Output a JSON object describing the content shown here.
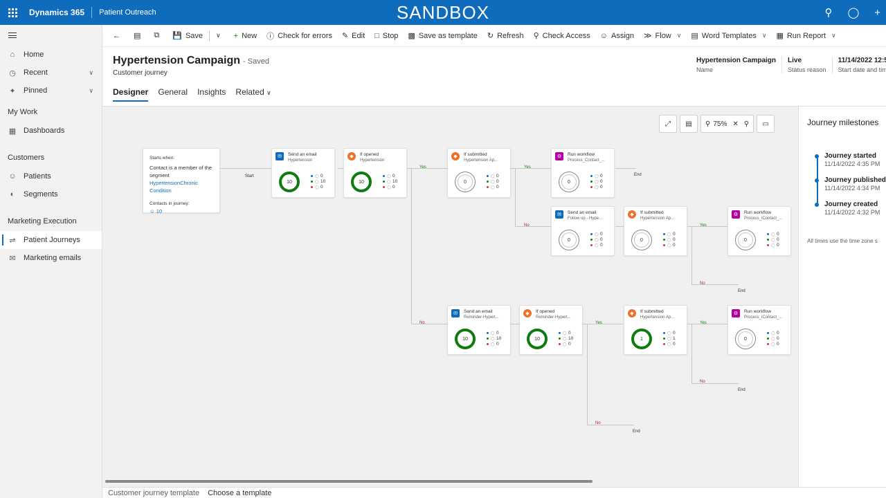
{
  "topbar": {
    "brand": "Dynamics 365",
    "app_name": "Patient Outreach",
    "environment": "SANDBOX",
    "icons": [
      "search-icon",
      "lightbulb-icon",
      "plus-icon"
    ],
    "color": "#0f6cbd"
  },
  "leftnav": {
    "home": "Home",
    "recent": "Recent",
    "pinned": "Pinned",
    "my_work": "My Work",
    "dashboards": "Dashboards",
    "customers": "Customers",
    "patients": "Patients",
    "segments": "Segments",
    "marketing_execution": "Marketing Execution",
    "patient_journeys": "Patient Journeys",
    "marketing_emails": "Marketing emails"
  },
  "commandbar": {
    "save": "Save",
    "new": "New",
    "check_errors": "Check for errors",
    "edit": "Edit",
    "stop": "Stop",
    "save_template": "Save as template",
    "refresh": "Refresh",
    "check_access": "Check Access",
    "assign": "Assign",
    "flow": "Flow",
    "word_templates": "Word Templates",
    "run_report": "Run Report"
  },
  "header": {
    "title": "Hypertension Campaign",
    "saved": "- Saved",
    "subtitle": "Customer journey",
    "tabs": [
      "Designer",
      "General",
      "Insights",
      "Related"
    ],
    "fields": [
      {
        "value": "Hypertension Campaign",
        "label": "Name"
      },
      {
        "value": "Live",
        "label": "Status reason"
      },
      {
        "value": "11/14/2022 12:5",
        "label": "Start date and tim"
      }
    ]
  },
  "canvas": {
    "zoom": "75%",
    "start_tile": {
      "label": "Starts when:",
      "text_prefix": "Contact is a member of the segment ",
      "segment_link": "HypertensionChronic Condition",
      "contacts_label": "Contacts in journey:",
      "contacts_count": "10"
    },
    "start_label": "Start",
    "tiles": [
      {
        "kind": "email",
        "title": "Send an email",
        "sub": "Hypertension",
        "donut": "10",
        "donut_style": "green",
        "stats": [
          "0",
          "10",
          "0"
        ]
      },
      {
        "kind": "cond",
        "title": "If opened",
        "sub": "Hypertension",
        "donut": "10",
        "donut_style": "green",
        "stats": [
          "0",
          "10",
          "0"
        ]
      },
      {
        "kind": "cond",
        "title": "If submitted",
        "sub": "Hypertension Ap...",
        "donut": "0",
        "donut_style": "gray",
        "stats": [
          "0",
          "0",
          "0"
        ]
      },
      {
        "kind": "wf",
        "title": "Run workflow",
        "sub": "Process_Contact_...",
        "donut": "0",
        "donut_style": "gray",
        "stats": [
          "0",
          "0",
          "0"
        ]
      },
      {
        "kind": "email",
        "title": "Send an email",
        "sub": "Follow up - Hype...",
        "donut": "0",
        "donut_style": "gray",
        "stats": [
          "0",
          "0",
          "0"
        ]
      },
      {
        "kind": "cond",
        "title": "If submitted",
        "sub": "Hypertension Ap...",
        "donut": "0",
        "donut_style": "gray",
        "stats": [
          "0",
          "0",
          "0"
        ]
      },
      {
        "kind": "wf",
        "title": "Run workflow",
        "sub": "Process_iContact_...",
        "donut": "0",
        "donut_style": "gray",
        "stats": [
          "0",
          "0",
          "0"
        ]
      },
      {
        "kind": "email",
        "title": "Send an email",
        "sub": "Reminder-Hypert...",
        "donut": "10",
        "donut_style": "green",
        "stats": [
          "0",
          "10",
          "0"
        ]
      },
      {
        "kind": "cond",
        "title": "If opened",
        "sub": "Reminder-Hypert...",
        "donut": "10",
        "donut_style": "green",
        "stats": [
          "0",
          "10",
          "0"
        ]
      },
      {
        "kind": "cond",
        "title": "If submitted",
        "sub": "Hypertension Ap...",
        "donut": "1",
        "donut_style": "green",
        "stats": [
          "0",
          "1",
          "0"
        ]
      },
      {
        "kind": "wf",
        "title": "Run workflow",
        "sub": "Process_iContact_...",
        "donut": "0",
        "donut_style": "gray",
        "stats": [
          "0",
          "0",
          "0"
        ]
      }
    ],
    "labels": {
      "yes": "Yes",
      "no": "No",
      "end": "End"
    }
  },
  "milestones": {
    "title": "Journey milestones",
    "items": [
      {
        "name": "Journey started",
        "date": "11/14/2022 4:35 PM"
      },
      {
        "name": "Journey published",
        "date": "11/14/2022 4:34 PM"
      },
      {
        "name": "Journey created",
        "date": "11/14/2022 4:32 PM"
      }
    ],
    "note": "All times use the time zone s"
  },
  "footer": {
    "label": "Customer journey template",
    "value": "Choose a template"
  }
}
